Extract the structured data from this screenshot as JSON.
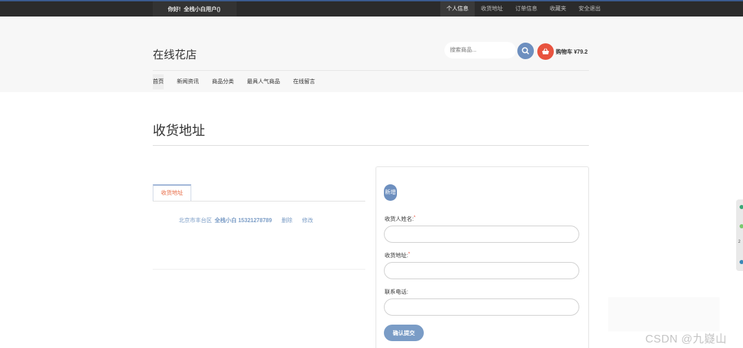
{
  "topbar": {
    "greeting_prefix": "你好!",
    "greeting_user": "全栈小白用户()",
    "links": [
      "个人信息",
      "收货地址",
      "订单信息",
      "收藏夹",
      "安全退出"
    ],
    "active_link": "个人信息"
  },
  "header": {
    "logo": "在线花店",
    "search_placeholder": "搜索商品...",
    "cart_label": "购物车 ¥79.2"
  },
  "mainnav": {
    "items": [
      "首页",
      "新闻资讯",
      "商品分类",
      "最具人气商品",
      "在线留言"
    ],
    "active": "首页"
  },
  "page": {
    "title": "收货地址"
  },
  "address_tab": {
    "label": "收货地址"
  },
  "address_list": [
    {
      "region": "北京市丰台区",
      "name_phone": "全栈小白 15321278789",
      "delete": "删除",
      "edit": "修改"
    }
  ],
  "form": {
    "badge": "新增",
    "name_label": "收货人姓名:",
    "address_label": "收货地址:",
    "phone_label": "联系电话:",
    "required_mark": "*",
    "submit": "确认提交"
  },
  "side_widget": {
    "number": "2"
  },
  "watermark": "CSDN @九嶷山",
  "colors": {
    "accent": "#6d8fbf",
    "cart": "#e8533f",
    "tab_text": "#e86b45",
    "link": "#7a9cc6",
    "topbar": "#2b2b2b"
  }
}
